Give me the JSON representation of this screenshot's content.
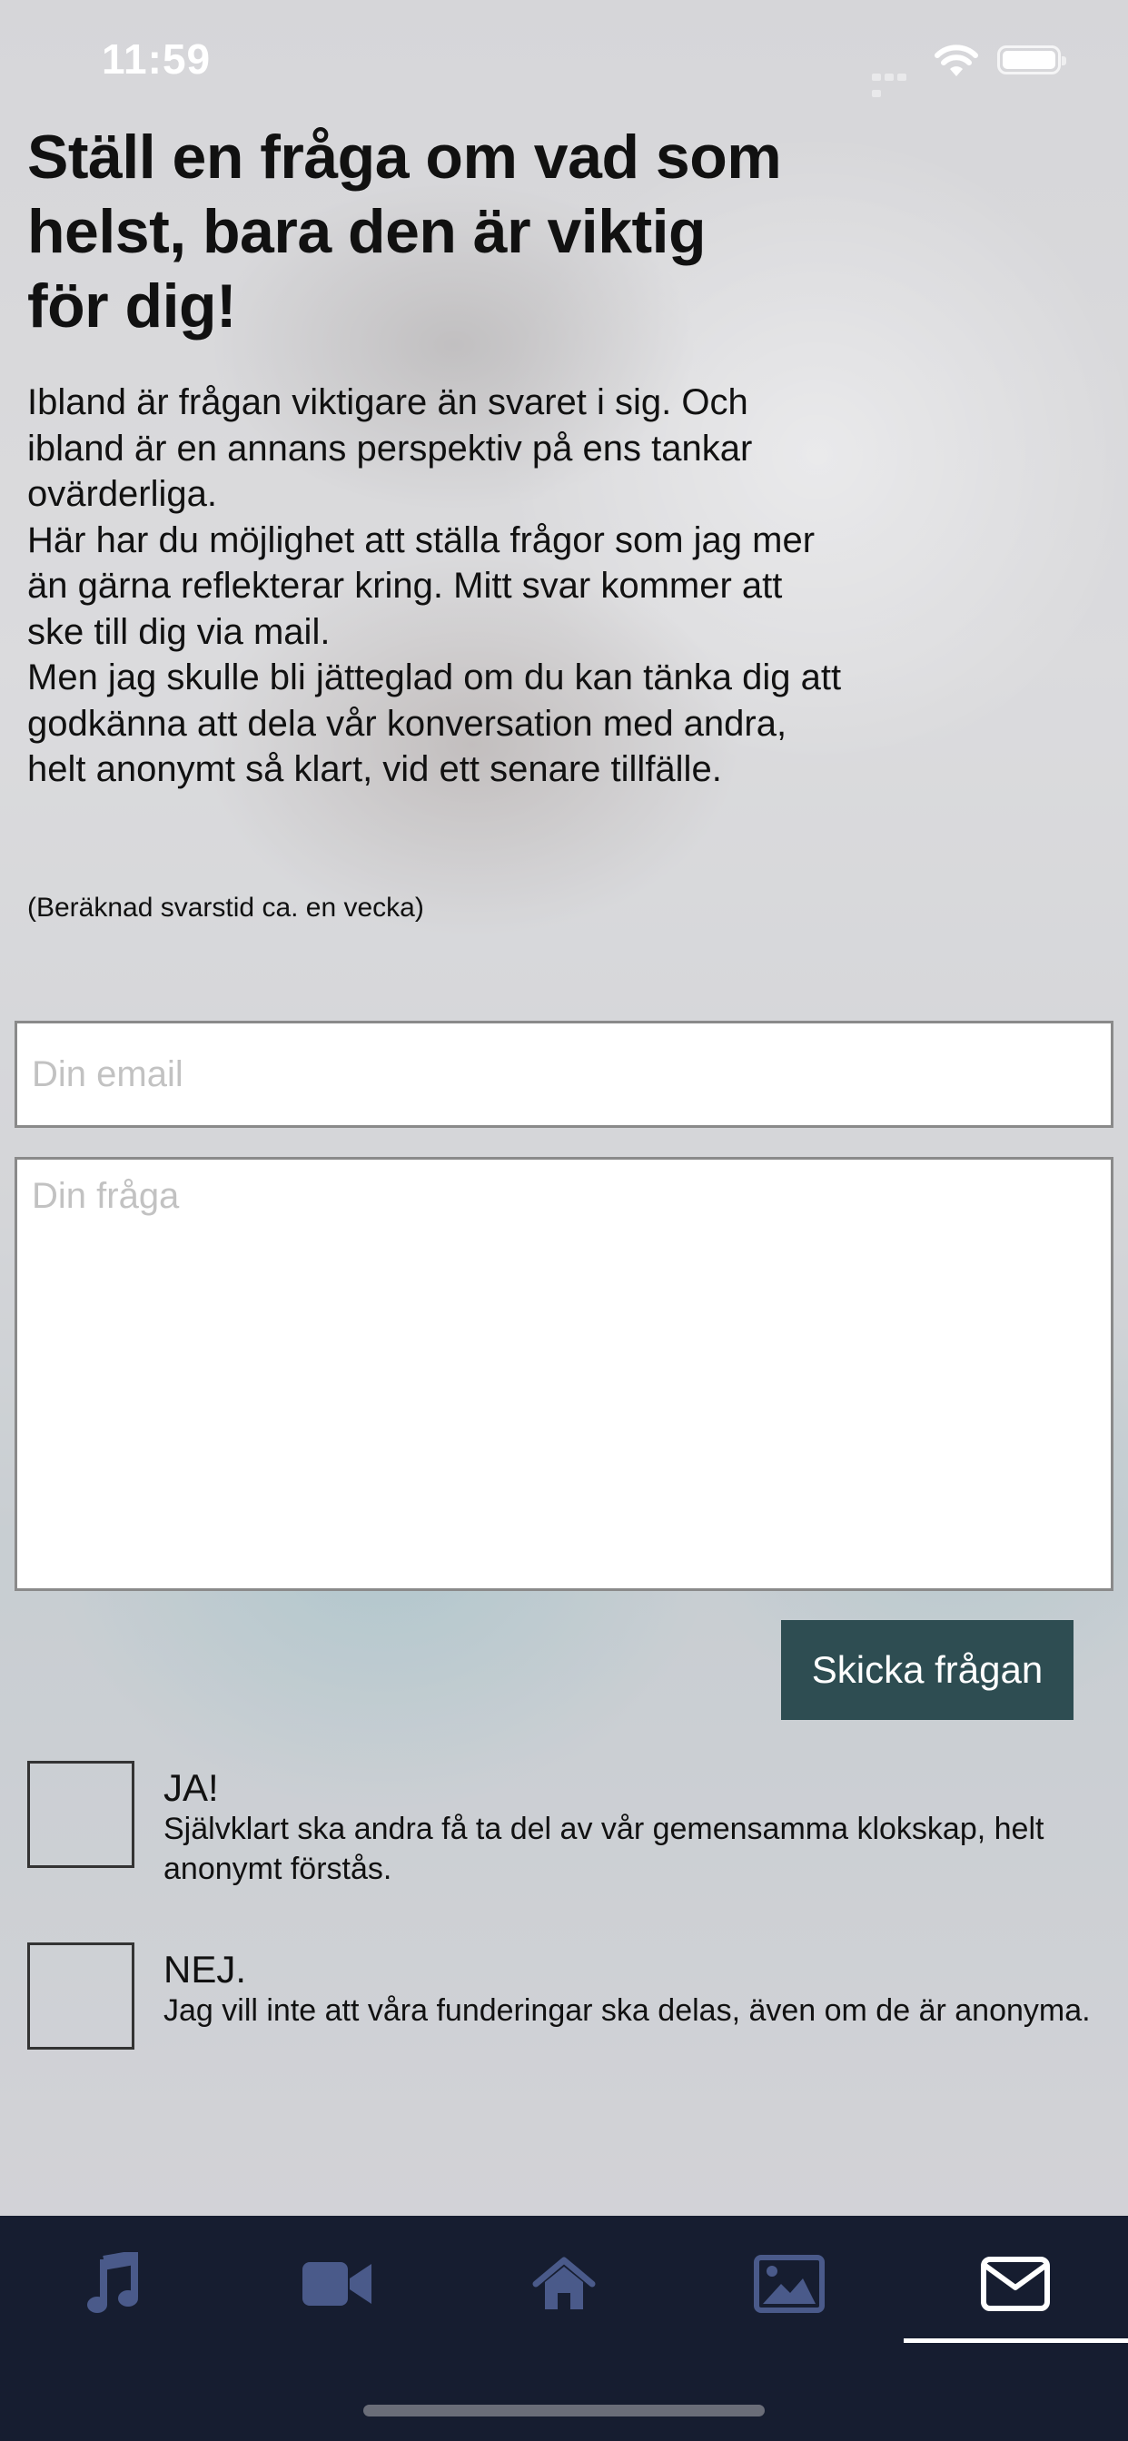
{
  "status_bar": {
    "time": "11:59"
  },
  "page": {
    "title_lines": [
      "Ställ en fråga om vad som",
      "helst, bara den är viktig",
      "för dig!"
    ],
    "intro_paragraphs": [
      "Ibland är frågan viktigare än svaret i sig. Och ibland är en annans perspektiv på ens tankar ovärderliga.",
      "Här har du möjlighet att ställa frågor som jag mer än gärna reflekterar kring. Mitt svar kommer att ske till dig via mail.",
      "Men jag skulle bli jätteglad om du kan tänka dig att godkänna att dela vår konversation med andra, helt anonymt så klart, vid ett senare tillfälle."
    ],
    "estimate": "(Beräknad svarstid ca. en vecka)"
  },
  "form": {
    "email_placeholder": "Din email",
    "email_value": "",
    "question_placeholder": "Din fråga",
    "question_value": "",
    "send_label": "Skicka frågan"
  },
  "consent": {
    "yes": {
      "title": "JA!",
      "description": "Självklart ska andra få ta del av vår gemensamma klokskap, helt anonymt förstås.",
      "checked": false
    },
    "no": {
      "title": "NEJ.",
      "description": "Jag vill inte att våra funderingar ska delas, även om de är anonyma.",
      "checked": false
    }
  },
  "tab_bar": {
    "tabs": [
      {
        "icon": "music-note-icon",
        "active": false
      },
      {
        "icon": "video-camera-icon",
        "active": false
      },
      {
        "icon": "home-icon",
        "active": false
      },
      {
        "icon": "image-icon",
        "active": false
      },
      {
        "icon": "envelope-icon",
        "active": true
      }
    ]
  },
  "colors": {
    "button_bg": "#2e4d52",
    "tab_bar_bg": "#161d30",
    "tab_icon_inactive": "#4a5a8a",
    "tab_icon_active": "#ffffff"
  }
}
